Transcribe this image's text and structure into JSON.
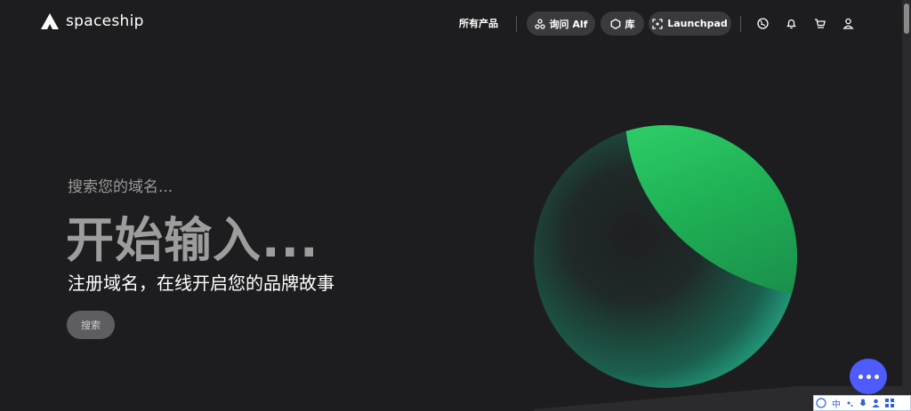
{
  "header": {
    "brand": "spaceship",
    "all_products": "所有产品",
    "ask_alf": "询问 Alf",
    "library": "库",
    "launchpad": "Launchpad"
  },
  "hero": {
    "prompt": "搜索您的域名...",
    "headline": "开始输入...",
    "tagline": "注册域名，在线开启您的品牌故事",
    "search_button": "搜索"
  },
  "ime": {
    "mode": "中"
  },
  "colors": {
    "background": "#1d1d1f",
    "pill": "#3a3a3d",
    "orb_teal": "#2ee0b0",
    "orb_green": "#1fb055",
    "chat": "#4d5bff"
  }
}
